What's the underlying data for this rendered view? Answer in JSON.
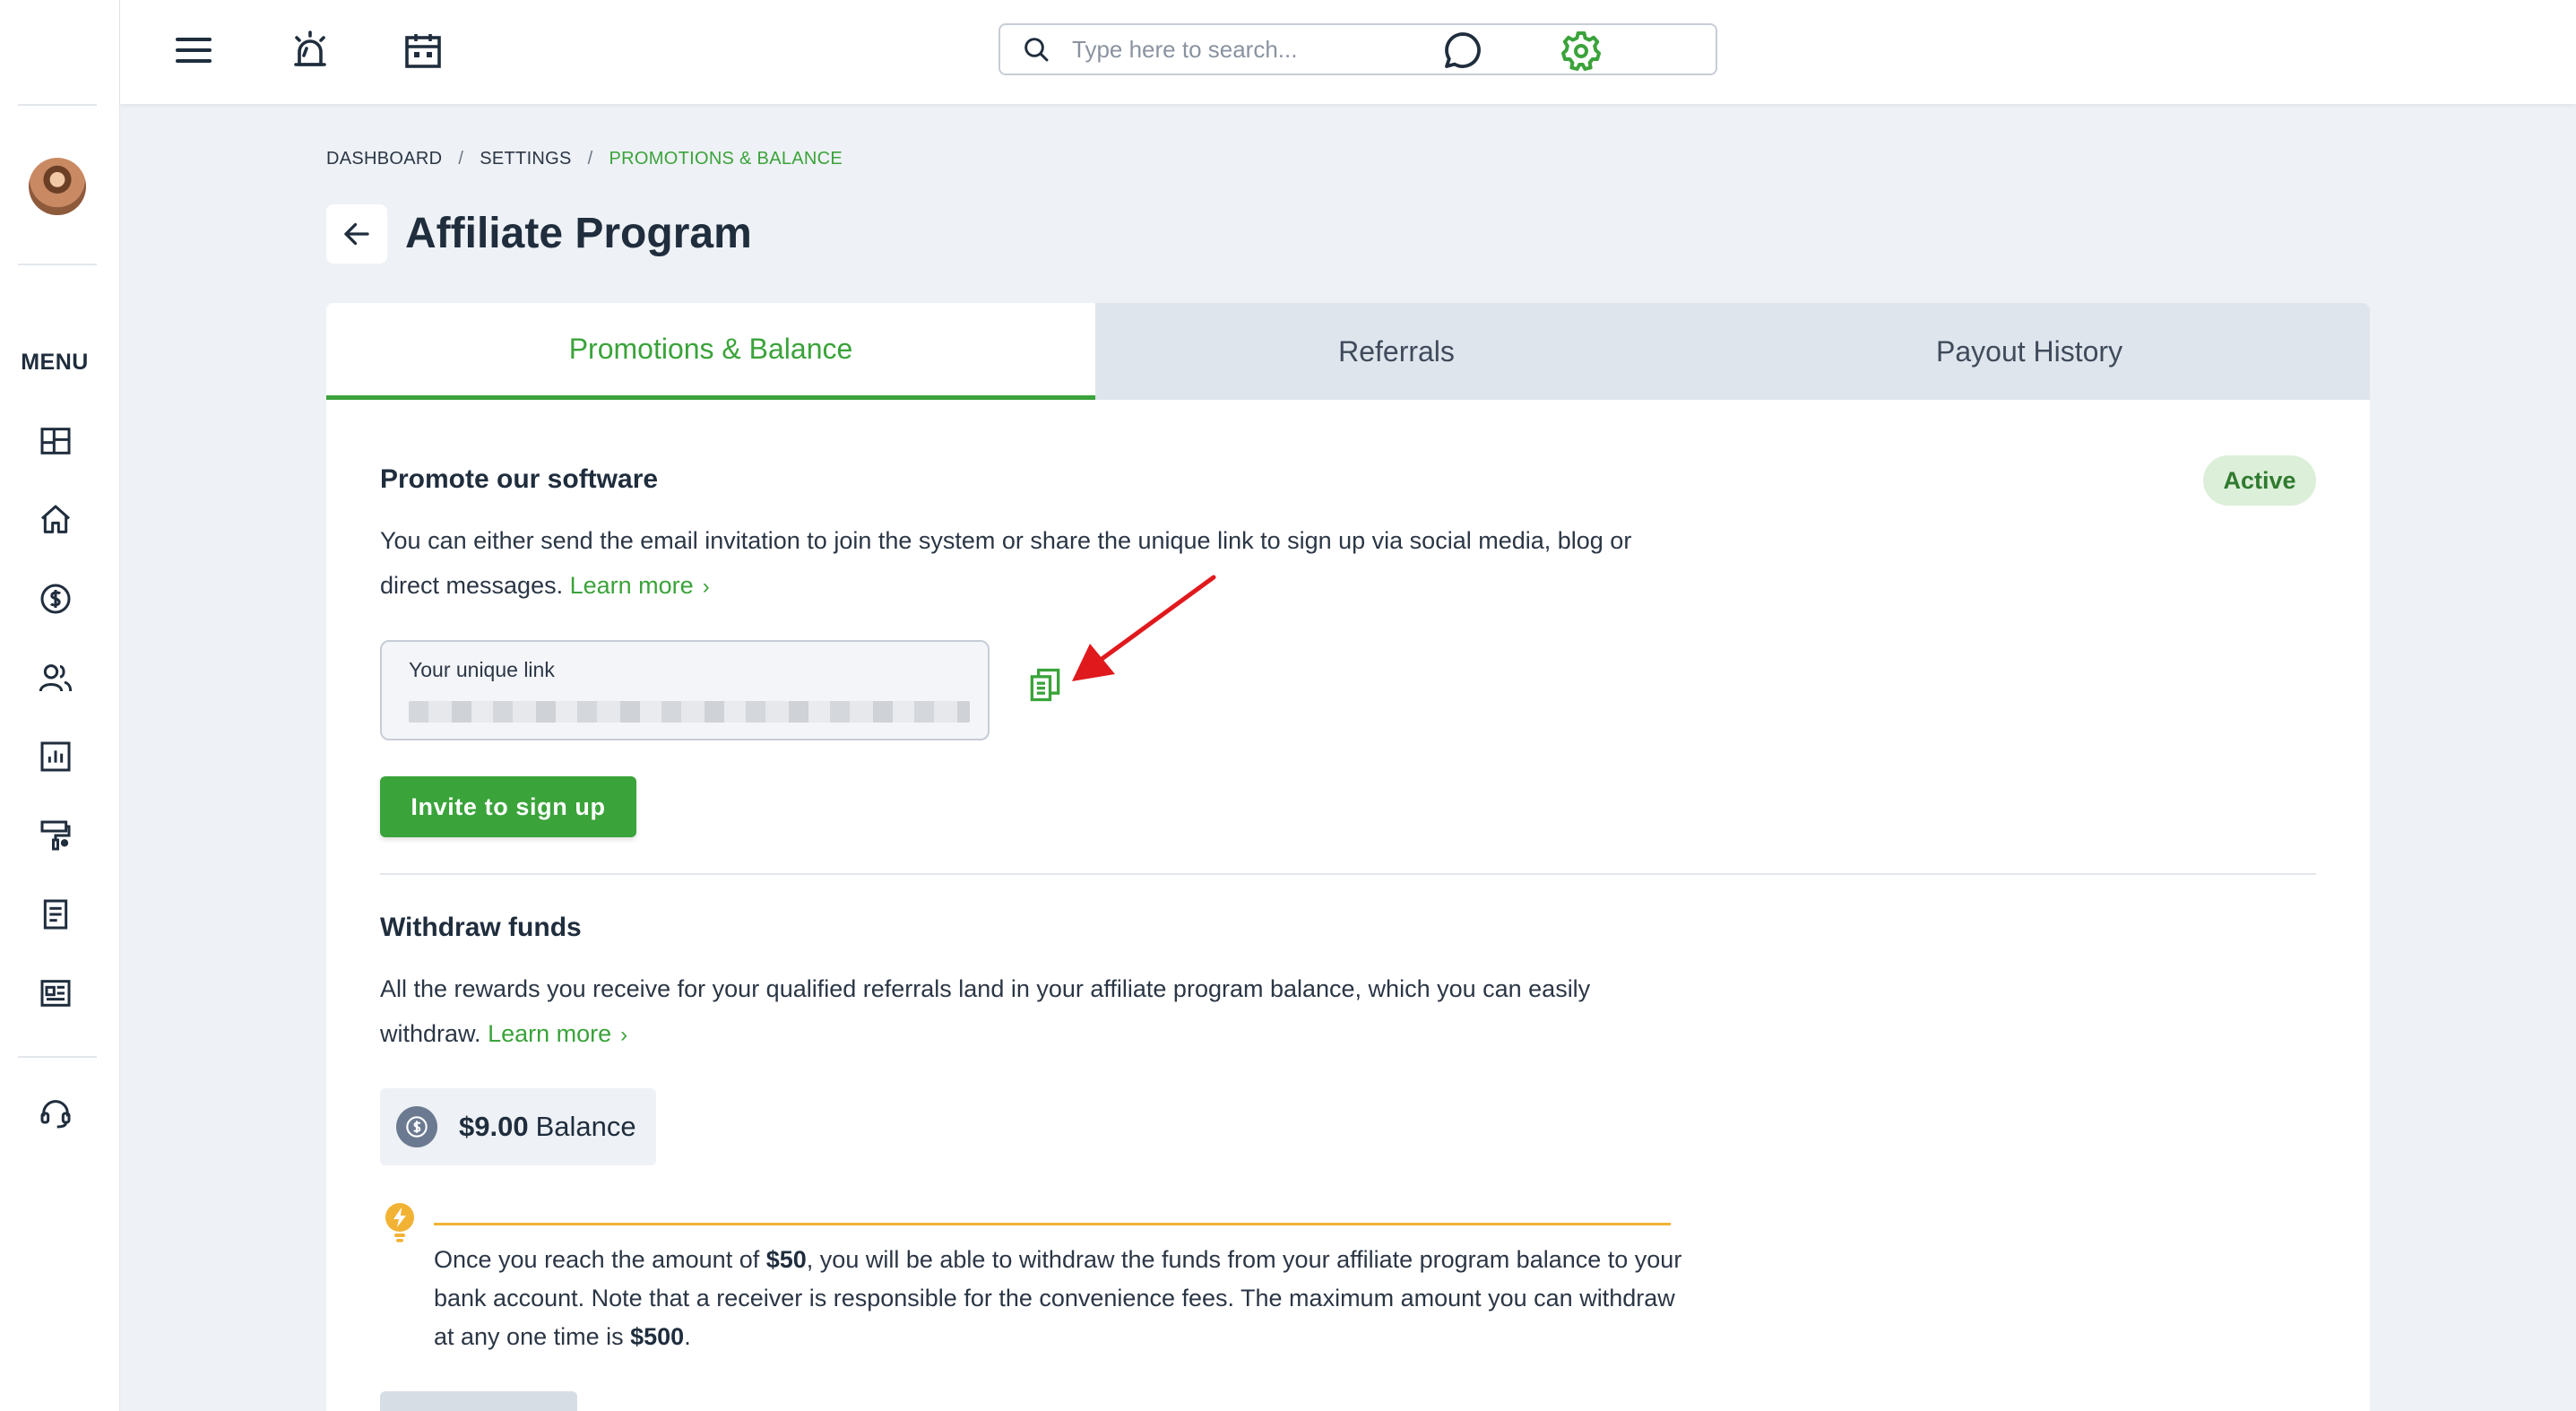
{
  "search": {
    "placeholder": "Type here to search..."
  },
  "sidebar": {
    "menu_label": "MENU",
    "items": [
      {
        "name": "dashboard",
        "icon": "layout-grid-icon"
      },
      {
        "name": "home",
        "icon": "home-icon"
      },
      {
        "name": "payments",
        "icon": "dollar-circle-icon"
      },
      {
        "name": "customers",
        "icon": "users-icon"
      },
      {
        "name": "reports",
        "icon": "bar-chart-icon"
      },
      {
        "name": "marketing",
        "icon": "paint-roller-icon"
      },
      {
        "name": "documents",
        "icon": "document-icon"
      },
      {
        "name": "news",
        "icon": "newspaper-icon"
      },
      {
        "name": "support",
        "icon": "headset-icon"
      }
    ]
  },
  "breadcrumb": {
    "items": [
      "DASHBOARD",
      "SETTINGS",
      "PROMOTIONS & BALANCE"
    ],
    "separator": "/"
  },
  "page": {
    "title": "Affiliate Program"
  },
  "tabs": [
    {
      "label": "Promotions & Balance",
      "active": true
    },
    {
      "label": "Referrals",
      "active": false
    },
    {
      "label": "Payout History",
      "active": false
    }
  ],
  "promote": {
    "title": "Promote our software",
    "status": "Active",
    "description_line1": "You can either send the email invitation to join the system or share the unique link to sign up via social media, blog or",
    "description_line2": "direct messages.",
    "learn_more": "Learn more",
    "link_label": "Your unique link",
    "invite_button": "Invite to sign up"
  },
  "withdraw": {
    "title": "Withdraw funds",
    "description_line1": "All the rewards you receive for your qualified referrals land in your affiliate program balance, which you can easily",
    "description_line2": "withdraw.",
    "learn_more": "Learn more",
    "balance_amount": "$9.00",
    "balance_label": "Balance",
    "tip": {
      "p1": "Once you reach the amount of ",
      "min_amount": "$50",
      "p2": ", you will be able to withdraw the funds from your affiliate program balance to your bank account. Note that a receiver is responsible for the convenience fees. The maximum amount you can withdraw at any one time is ",
      "max_amount": "$500",
      "p3": "."
    }
  },
  "colors": {
    "accent": "#3aa33a",
    "tab_inactive_bg": "#dfe5ec",
    "badge_bg": "#dcefd9",
    "tip_line": "#f2b233",
    "annotation_arrow": "#e0191c"
  }
}
